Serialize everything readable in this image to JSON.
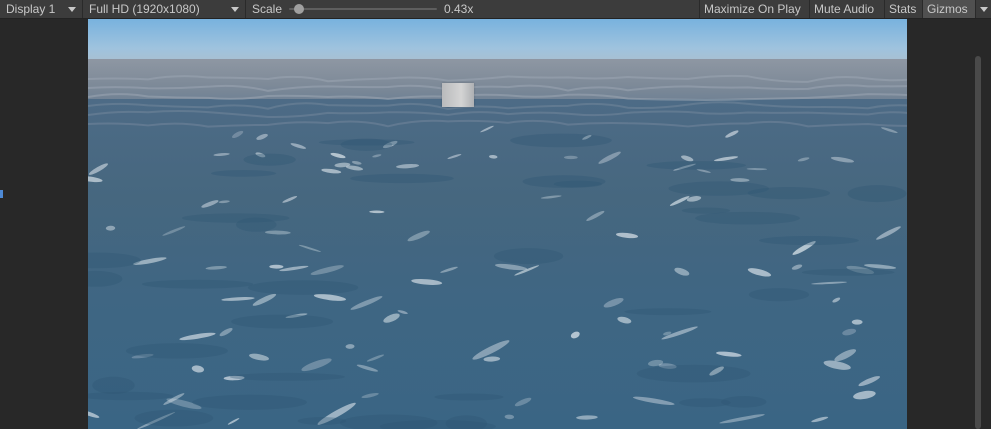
{
  "toolbar": {
    "display_label": "Display 1",
    "resolution_label": "Full HD (1920x1080)",
    "scale_label": "Scale",
    "scale_value": "0.43x",
    "scale_fraction": 0.0,
    "maximize_label": "Maximize On Play",
    "mute_label": "Mute Audio",
    "stats_label": "Stats",
    "gizmos_label": "Gizmos"
  },
  "colors": {
    "toolbar_bg": "#3c3c3c",
    "editor_bg": "#282828",
    "sky": "#9fc3de",
    "ocean": "#3f6683",
    "foam": "#e6edf2"
  }
}
